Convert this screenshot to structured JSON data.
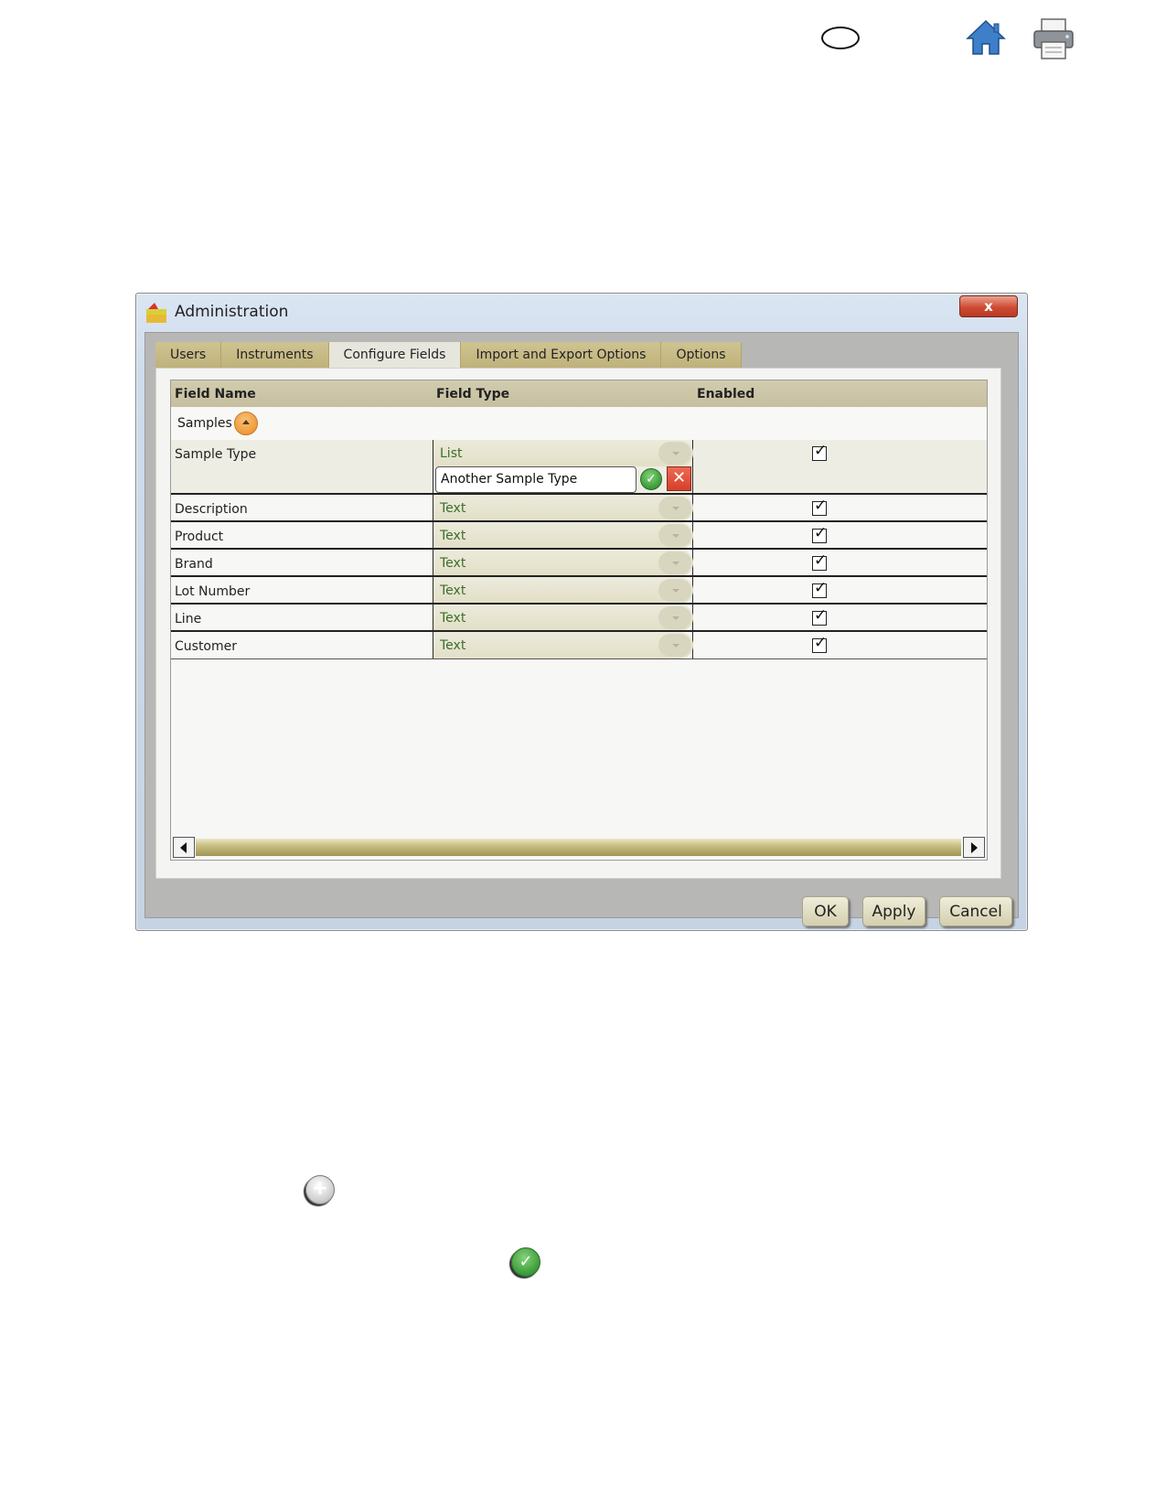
{
  "page_icons": [
    "oval-icon",
    "home-icon",
    "print-icon",
    "add-icon",
    "check-icon"
  ],
  "window": {
    "title": "Administration",
    "close_label": "x",
    "tabs": [
      {
        "label": "Users",
        "active": false
      },
      {
        "label": "Instruments",
        "active": false
      },
      {
        "label": "Configure Fields",
        "active": true
      },
      {
        "label": "Import and Export Options",
        "active": false
      },
      {
        "label": "Options",
        "active": false
      }
    ],
    "grid": {
      "headers": {
        "field_name": "Field Name",
        "field_type": "Field Type",
        "enabled": "Enabled"
      },
      "group": "Samples",
      "rows": [
        {
          "name": "Sample Type",
          "type": "List",
          "enabled": true,
          "edit_value": "Another Sample Type"
        },
        {
          "name": "Description",
          "type": "Text",
          "enabled": true
        },
        {
          "name": "Product",
          "type": "Text",
          "enabled": true
        },
        {
          "name": "Brand",
          "type": "Text",
          "enabled": true
        },
        {
          "name": "Lot Number",
          "type": "Text",
          "enabled": true
        },
        {
          "name": "Line",
          "type": "Text",
          "enabled": true
        },
        {
          "name": "Customer",
          "type": "Text",
          "enabled": true
        }
      ]
    },
    "buttons": {
      "ok": "OK",
      "apply": "Apply",
      "cancel": "Cancel"
    }
  },
  "colors": {
    "tab_bg": "#c4b77f",
    "type_text": "#3b6e2a",
    "accept": "#3a9b37",
    "reject": "#d43f2a",
    "collapse": "#ef9b3a"
  }
}
